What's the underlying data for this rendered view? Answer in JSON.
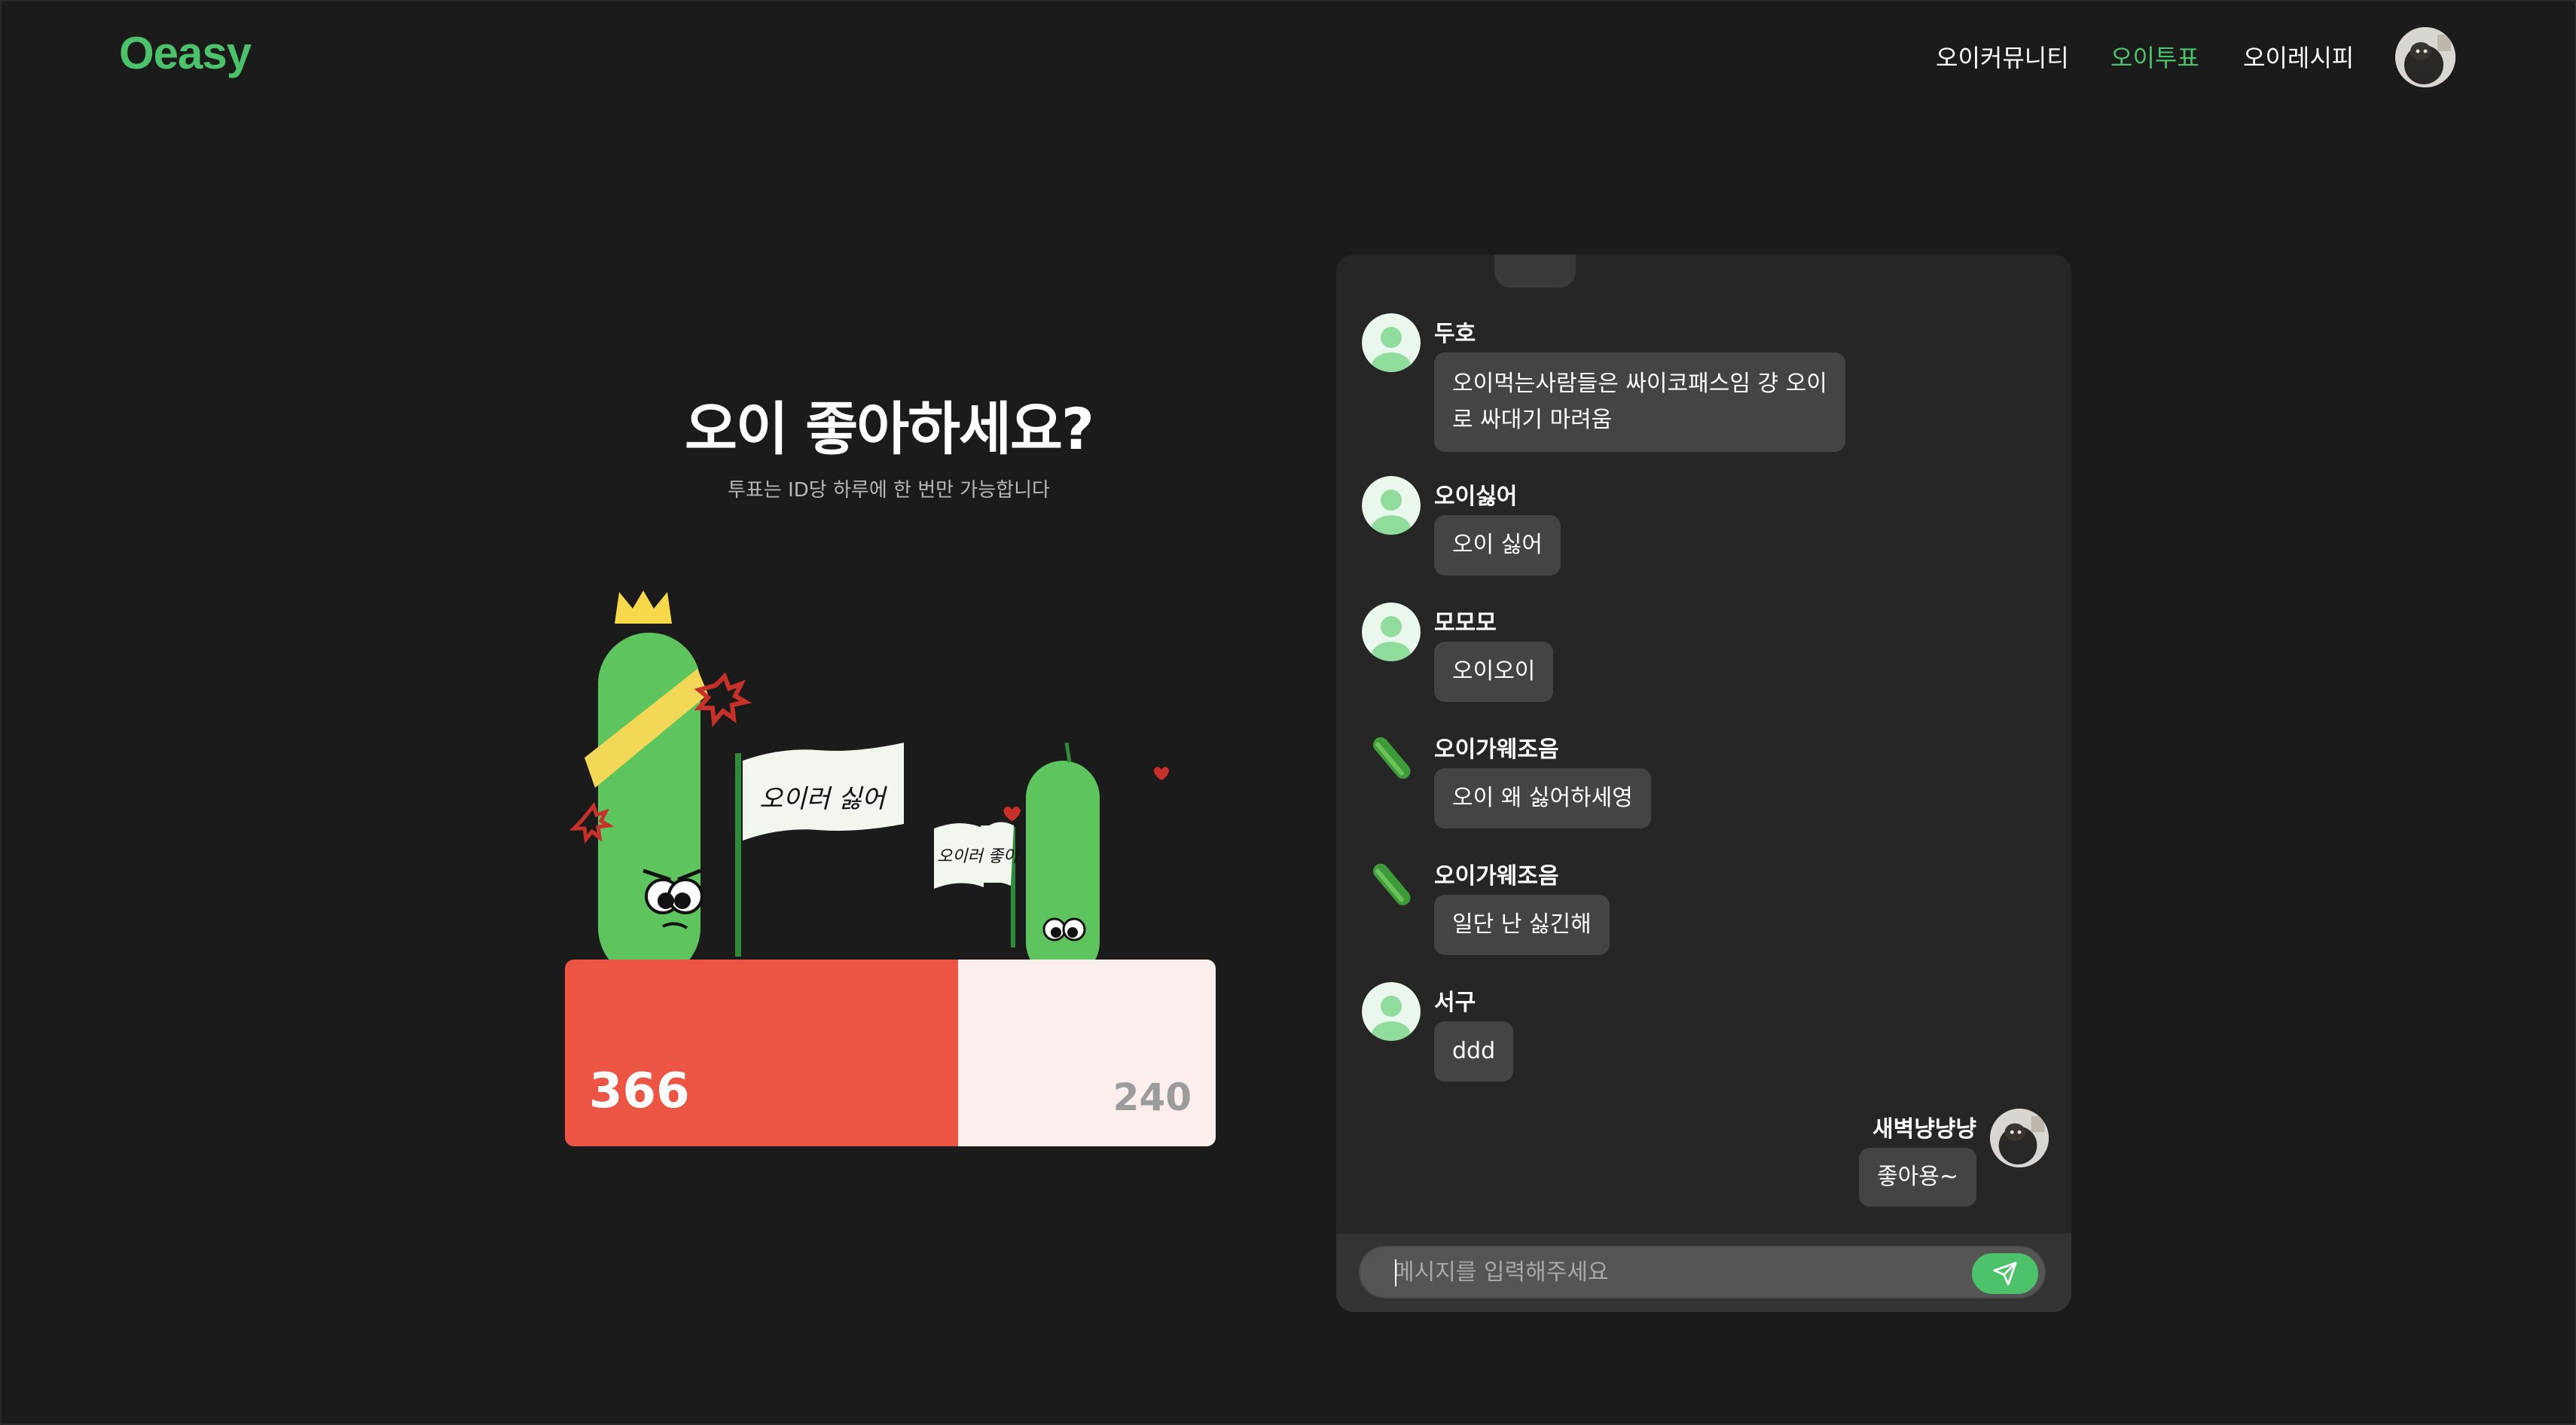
{
  "header": {
    "logo": "Oeasy",
    "nav": [
      {
        "label": "오이커뮤니티",
        "active": false
      },
      {
        "label": "오이투표",
        "active": true
      },
      {
        "label": "오이레시피",
        "active": false
      }
    ],
    "profile_icon": "user-avatar-photo"
  },
  "vote": {
    "title": "오이 좋아하세요?",
    "subtitle": "투표는 ID당 하루에 한 번만 가능합니다",
    "illustration": {
      "left_flag": "오이러 싫어",
      "right_flag": "오이러 좋아"
    },
    "left_count": "366",
    "right_count": "240",
    "left_share": 0.604,
    "colors": {
      "left": "#ec5444",
      "right": "#fdeeee"
    }
  },
  "chat": {
    "messages": [
      {
        "name": "두호",
        "avatar": "default-avatar",
        "lines": [
          "오이먹는사람들은 싸이코패스임 걍 오이",
          "로 싸대기 마려움"
        ]
      },
      {
        "name": "오이싫어",
        "avatar": "default-avatar",
        "lines": [
          "오이 싫어"
        ]
      },
      {
        "name": "모모모",
        "avatar": "default-avatar",
        "lines": [
          "오이오이"
        ]
      },
      {
        "name": "오이가웨조음",
        "avatar": "cucumber-avatar",
        "lines": [
          "오이 왜 싫어하세영"
        ]
      },
      {
        "name": "오이가웨조음",
        "avatar": "cucumber-avatar",
        "lines": [
          "일단 난 싫긴해"
        ]
      },
      {
        "name": "서구",
        "avatar": "default-avatar",
        "lines": [
          "ddd"
        ]
      }
    ],
    "my_message": {
      "name": "새벽냥냥냥",
      "text": "좋아용~",
      "avatar": "user-avatar-photo"
    },
    "input": {
      "placeholder": "메시지를 입력해주세요",
      "value": ""
    },
    "send_icon": "send-icon"
  }
}
